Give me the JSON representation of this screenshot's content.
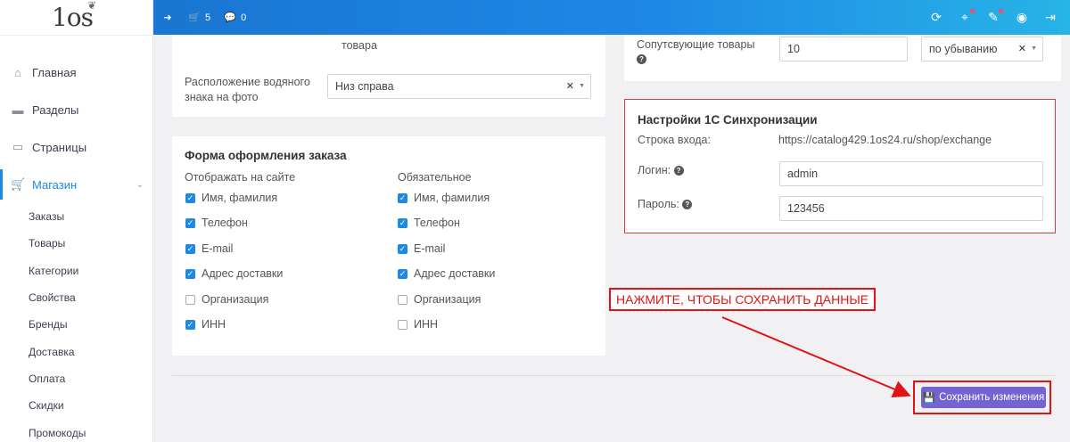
{
  "logo": {
    "text": "1os"
  },
  "sidebar": {
    "items": [
      {
        "label": "Главная",
        "icon": "home-icon"
      },
      {
        "label": "Разделы",
        "icon": "folder-icon"
      },
      {
        "label": "Страницы",
        "icon": "file-icon"
      },
      {
        "label": "Магазин",
        "icon": "cart-icon"
      }
    ],
    "shop_sub": [
      "Заказы",
      "Товары",
      "Категории",
      "Свойства",
      "Бренды",
      "Доставка",
      "Оплата",
      "Скидки",
      "Промокоды"
    ]
  },
  "topbar": {
    "cart_count": "5",
    "comments_count": "0"
  },
  "watermark": {
    "cut_text": "товара",
    "position_label_1": "Расположение водяного",
    "position_label_2": "знака на фото",
    "position_value": "Низ справа"
  },
  "order_form": {
    "title": "Форма оформления заказа",
    "col_show": "Отображать на сайте",
    "col_required": "Обязательное",
    "fields": [
      {
        "label": "Имя, фамилия",
        "show": true,
        "required": true
      },
      {
        "label": "Телефон",
        "show": true,
        "required": true
      },
      {
        "label": "E-mail",
        "show": true,
        "required": true
      },
      {
        "label": "Адрес доставки",
        "show": true,
        "required": true
      },
      {
        "label": "Организация",
        "show": false,
        "required": false
      },
      {
        "label": "ИНН",
        "show": true,
        "required": false
      }
    ]
  },
  "related": {
    "label": "Сопутсвующие товары",
    "count": "10",
    "sort": "по убыванию"
  },
  "sync": {
    "title": "Настройки 1С Синхронизации",
    "entry_label": "Строка входа:",
    "entry_value": "https://catalog429.1os24.ru/shop/exchange",
    "login_label": "Логин:",
    "login_value": "admin",
    "password_label": "Пароль:",
    "password_value": "123456"
  },
  "annotation": {
    "text": "НАЖМИТЕ, ЧТОБЫ СОХРАНИТЬ ДАННЫЕ"
  },
  "save_button": {
    "label": "Сохранить изменения"
  },
  "colors": {
    "accent": "#1e88e5",
    "save": "#7364d2",
    "annotation": "#e01414"
  }
}
